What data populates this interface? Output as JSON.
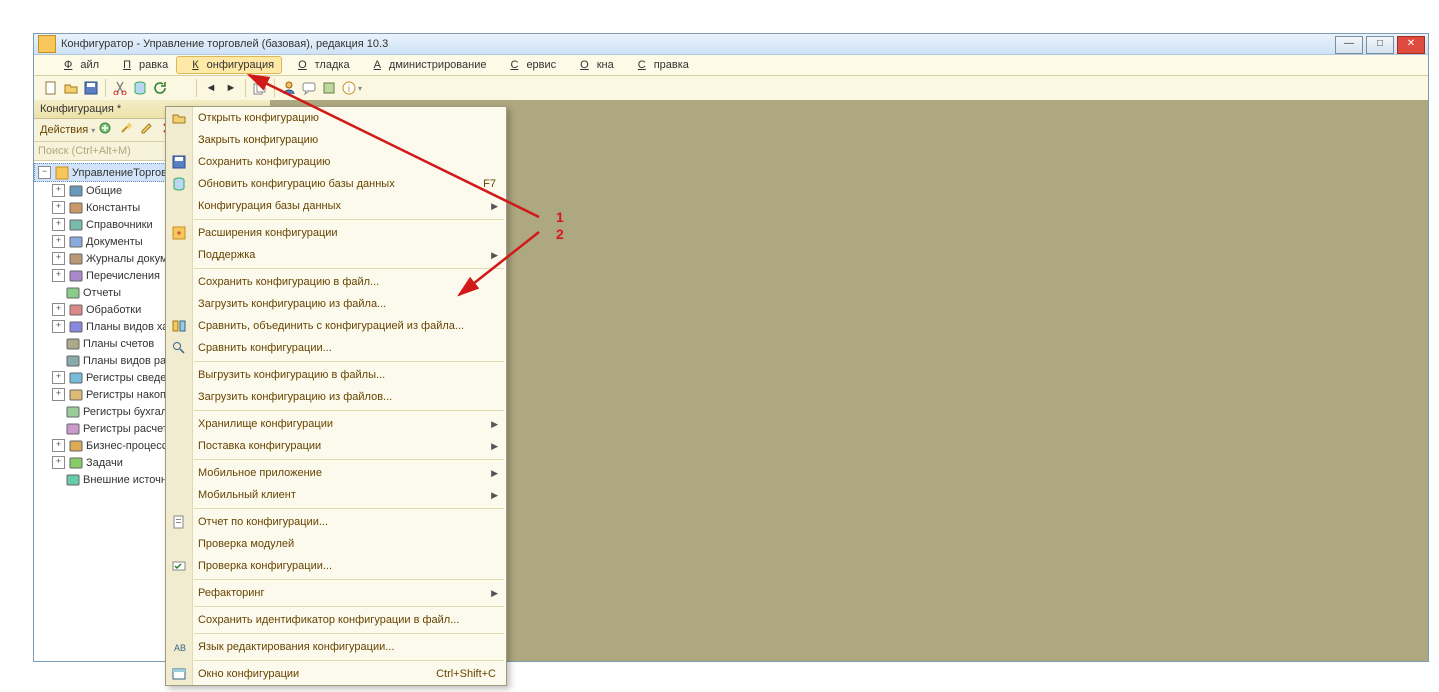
{
  "window": {
    "title": "Конфигуратор - Управление торговлей (базовая), редакция 10.3"
  },
  "menubar": {
    "items": [
      "Файл",
      "Правка",
      "Конфигурация",
      "Отладка",
      "Администрирование",
      "Сервис",
      "Окна",
      "Справка"
    ],
    "active_index": 2
  },
  "sidebar": {
    "title": "Конфигурация *",
    "actions_label": "Действия",
    "search_placeholder": "Поиск (Ctrl+Alt+M)",
    "root": "УправлениеТорговлей",
    "items": [
      {
        "label": "Общие",
        "expand": "+",
        "icon": "dots"
      },
      {
        "label": "Константы",
        "expand": "+",
        "icon": "const"
      },
      {
        "label": "Справочники",
        "expand": "+",
        "icon": "ref"
      },
      {
        "label": "Документы",
        "expand": "+",
        "icon": "doc"
      },
      {
        "label": "Журналы документов",
        "expand": "+",
        "icon": "journal"
      },
      {
        "label": "Перечисления",
        "expand": "+",
        "icon": "enum"
      },
      {
        "label": "Отчеты",
        "expand": "",
        "icon": "report"
      },
      {
        "label": "Обработки",
        "expand": "+",
        "icon": "proc"
      },
      {
        "label": "Планы видов характеристик",
        "expand": "+",
        "icon": "plan"
      },
      {
        "label": "Планы счетов",
        "expand": "",
        "icon": "chart"
      },
      {
        "label": "Планы видов расчета",
        "expand": "",
        "icon": "calc"
      },
      {
        "label": "Регистры сведений",
        "expand": "+",
        "icon": "reginfo"
      },
      {
        "label": "Регистры накопления",
        "expand": "+",
        "icon": "regacc"
      },
      {
        "label": "Регистры бухгалтерии",
        "expand": "",
        "icon": "regbook"
      },
      {
        "label": "Регистры расчета",
        "expand": "",
        "icon": "regcalc"
      },
      {
        "label": "Бизнес-процессы",
        "expand": "+",
        "icon": "bp"
      },
      {
        "label": "Задачи",
        "expand": "+",
        "icon": "task"
      },
      {
        "label": "Внешние источники данных",
        "expand": "",
        "icon": "ext"
      }
    ]
  },
  "dropdown": {
    "items": [
      {
        "label": "Открыть конфигурацию",
        "icon": "open"
      },
      {
        "label": "Закрыть конфигурацию"
      },
      {
        "label": "Сохранить конфигурацию",
        "icon": "save"
      },
      {
        "label": "Обновить конфигурацию базы данных",
        "icon": "update",
        "shortcut": "F7"
      },
      {
        "label": "Конфигурация базы данных",
        "submenu": true
      },
      {
        "sep": true
      },
      {
        "label": "Расширения конфигурации",
        "icon": "ext"
      },
      {
        "label": "Поддержка",
        "submenu": true
      },
      {
        "sep": true
      },
      {
        "label": "Сохранить конфигурацию в файл..."
      },
      {
        "label": "Загрузить конфигурацию из файла..."
      },
      {
        "label": "Сравнить, объединить с конфигурацией из файла...",
        "icon": "compare"
      },
      {
        "label": "Сравнить конфигурации...",
        "icon": "compare2"
      },
      {
        "sep": true
      },
      {
        "label": "Выгрузить конфигурацию в файлы..."
      },
      {
        "label": "Загрузить конфигурацию из файлов..."
      },
      {
        "sep": true
      },
      {
        "label": "Хранилище конфигурации",
        "submenu": true
      },
      {
        "label": "Поставка конфигурации",
        "submenu": true
      },
      {
        "sep": true
      },
      {
        "label": "Мобильное приложение",
        "submenu": true
      },
      {
        "label": "Мобильный клиент",
        "submenu": true
      },
      {
        "sep": true
      },
      {
        "label": "Отчет по конфигурации...",
        "icon": "report"
      },
      {
        "label": "Проверка модулей"
      },
      {
        "label": "Проверка конфигурации...",
        "icon": "check"
      },
      {
        "sep": true
      },
      {
        "label": "Рефакторинг",
        "submenu": true
      },
      {
        "sep": true
      },
      {
        "label": "Сохранить идентификатор конфигурации в файл..."
      },
      {
        "sep": true
      },
      {
        "label": "Язык редактирования конфигурации...",
        "icon": "lang"
      },
      {
        "sep": true
      },
      {
        "label": "Окно конфигурации",
        "shortcut": "Ctrl+Shift+C",
        "icon": "window"
      }
    ]
  },
  "annotations": {
    "label1": "1",
    "label2": "2"
  }
}
